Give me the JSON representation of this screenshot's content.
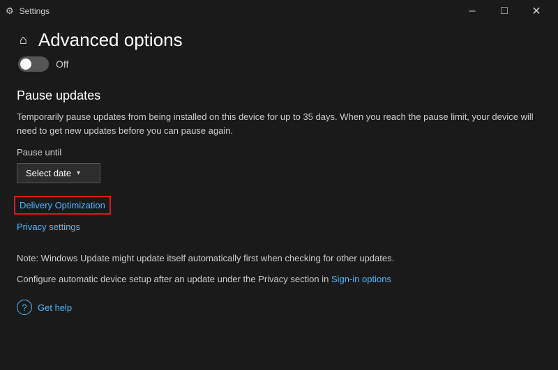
{
  "titlebar": {
    "title": "Settings",
    "minimize_label": "–",
    "maximize_label": "□",
    "close_label": "✕"
  },
  "header": {
    "page_title": "Advanced options",
    "toggle_state": "off",
    "toggle_label": "Off"
  },
  "pause_updates": {
    "section_title": "Pause updates",
    "description": "Temporarily pause updates from being installed on this device for up to 35 days. When you reach the pause limit, your device will need to get new updates before you can pause again.",
    "pause_until_label": "Pause until",
    "select_date_btn": "Select date"
  },
  "links": {
    "delivery_optimization": "Delivery Optimization",
    "privacy_settings": "Privacy settings"
  },
  "notes": {
    "note_text": "Note: Windows Update might update itself automatically first when checking for other updates.",
    "configure_text": "Configure automatic device setup after an update under the Privacy section in ",
    "sign_in_link": "Sign-in options"
  },
  "help": {
    "label": "Get help"
  }
}
